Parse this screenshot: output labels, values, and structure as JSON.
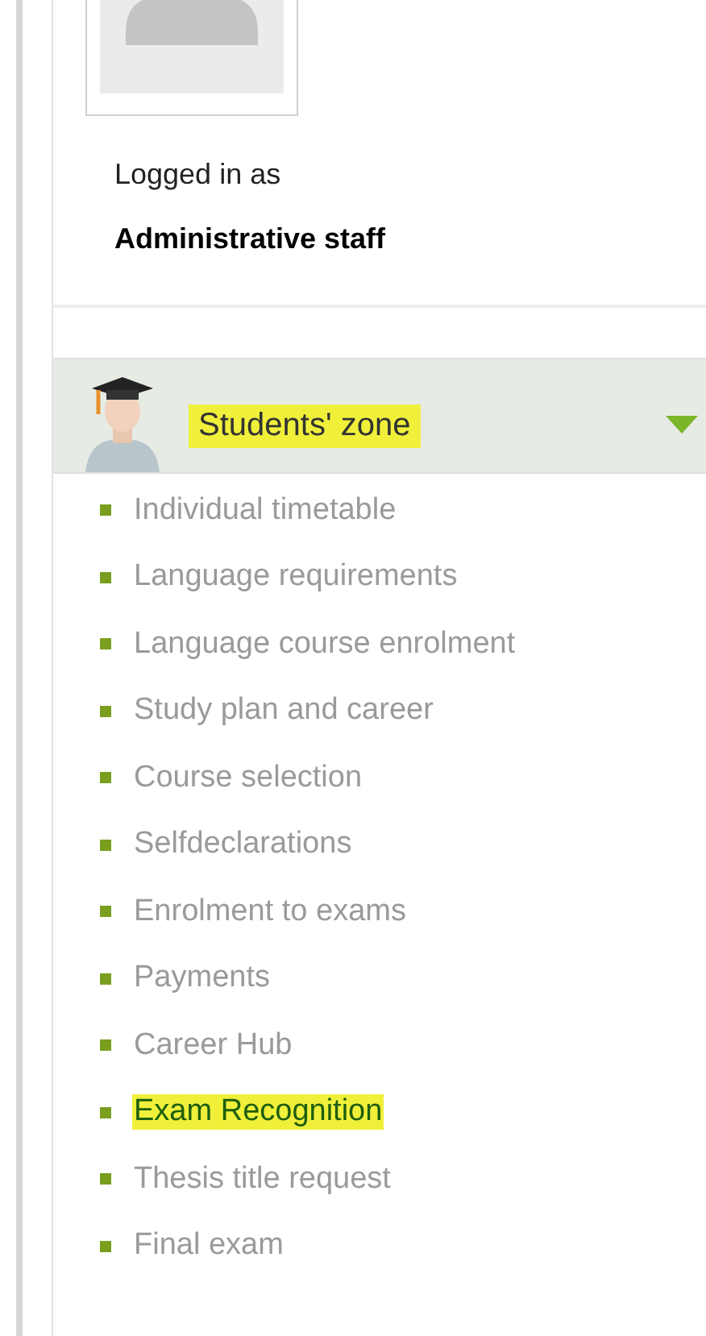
{
  "user": {
    "logged_in_label": "Logged in as",
    "role": "Administrative staff"
  },
  "section": {
    "title": "Students' zone",
    "highlighted": true,
    "expanded": true,
    "items": [
      {
        "label": "Individual timetable",
        "highlighted": false
      },
      {
        "label": "Language requirements",
        "highlighted": false
      },
      {
        "label": "Language course enrolment",
        "highlighted": false
      },
      {
        "label": "Study plan and career",
        "highlighted": false
      },
      {
        "label": "Course selection",
        "highlighted": false
      },
      {
        "label": "Selfdeclarations",
        "highlighted": false
      },
      {
        "label": "Enrolment to exams",
        "highlighted": false
      },
      {
        "label": "Payments",
        "highlighted": false
      },
      {
        "label": "Career Hub",
        "highlighted": false
      },
      {
        "label": "Exam Recognition",
        "highlighted": true
      },
      {
        "label": "Thesis title request",
        "highlighted": false
      },
      {
        "label": "Final exam",
        "highlighted": false
      }
    ]
  }
}
